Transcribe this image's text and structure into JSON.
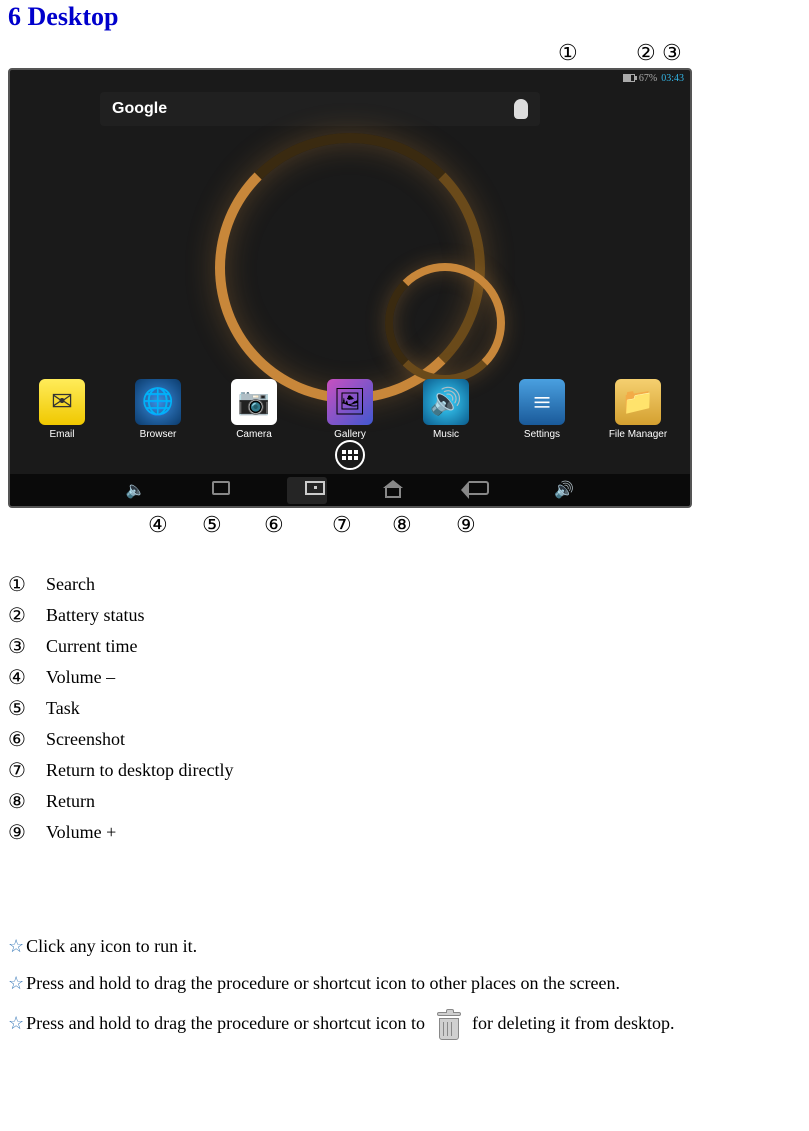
{
  "section_title": "6 Desktop",
  "callouts_top": {
    "c1": "①",
    "c2": "②",
    "c3": "③"
  },
  "callouts_bottom": {
    "c4": "④",
    "c5": "⑤",
    "c6": "⑥",
    "c7": "⑦",
    "c8": "⑧",
    "c9": "⑨"
  },
  "status": {
    "battery_text": "67%",
    "time": "03:43"
  },
  "search": {
    "logo": "Google"
  },
  "apps": {
    "email": "Email",
    "browser": "Browser",
    "camera": "Camera",
    "gallery": "Gallery",
    "music": "Music",
    "settings": "Settings",
    "file_manager": "File Manager"
  },
  "legend": {
    "i1": {
      "num": "①",
      "text": "Search"
    },
    "i2": {
      "num": "②",
      "text": "Battery status"
    },
    "i3": {
      "num": "③",
      "text": "Current time"
    },
    "i4": {
      "num": "④",
      "text": "Volume –"
    },
    "i5": {
      "num": "⑤",
      "text": "Task"
    },
    "i6": {
      "num": "⑥",
      "text": "Screenshot"
    },
    "i7": {
      "num": "⑦",
      "text": "Return to desktop directly"
    },
    "i8": {
      "num": "⑧",
      "text": "Return"
    },
    "i9": {
      "num": "⑨",
      "text": "Volume +"
    }
  },
  "tips": {
    "t1": "Click any icon to run it.",
    "t2": "Press and hold to drag the procedure or shortcut icon to other places on the screen.",
    "t3a": "Press and hold to drag the procedure or shortcut icon to",
    "t3b": "for deleting it from desktop."
  }
}
